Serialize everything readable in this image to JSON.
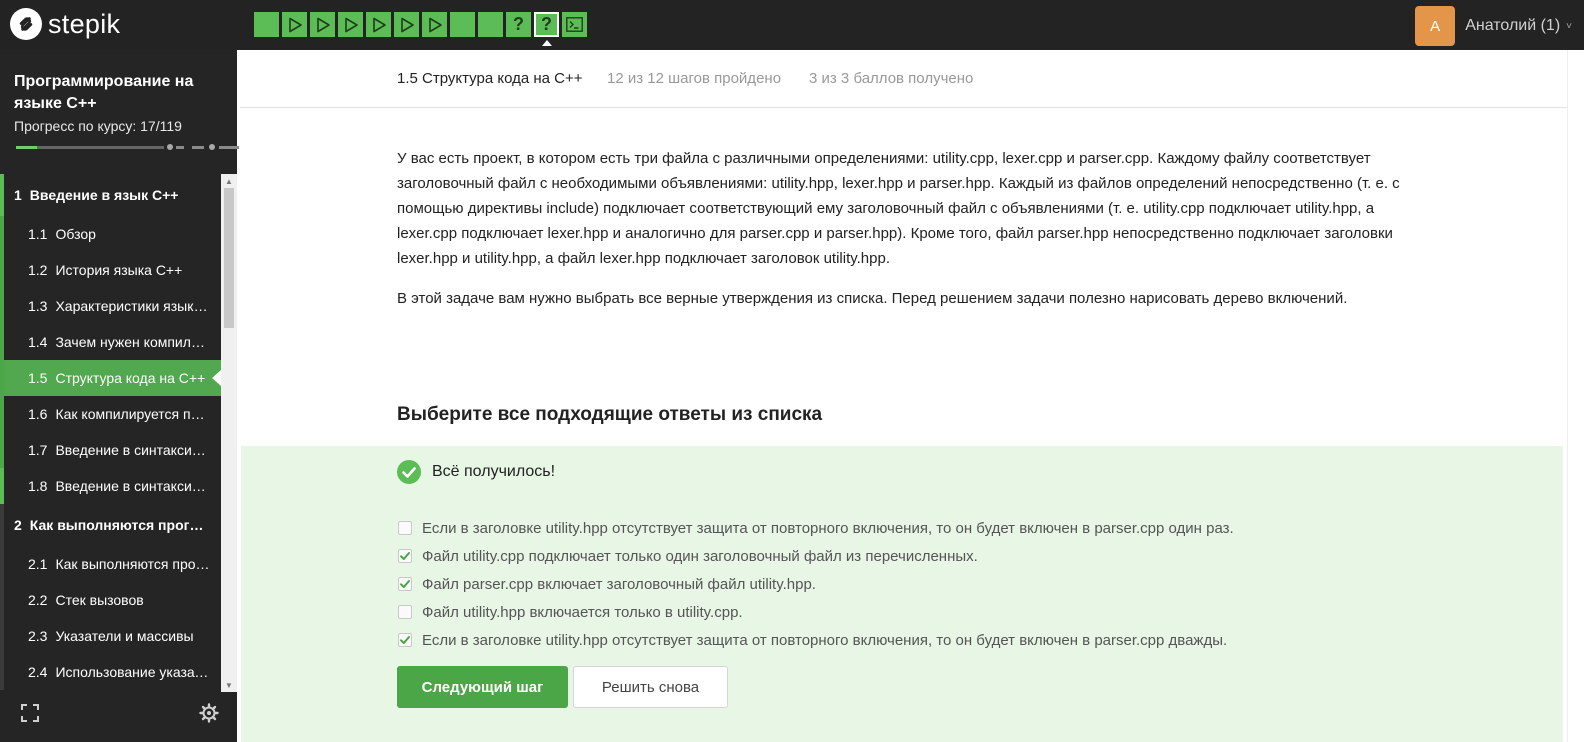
{
  "header": {
    "logo_text": "stepik",
    "steps": [
      {
        "type": "text",
        "state": "passed"
      },
      {
        "type": "video",
        "state": "passed"
      },
      {
        "type": "video",
        "state": "passed"
      },
      {
        "type": "video",
        "state": "passed"
      },
      {
        "type": "video",
        "state": "passed"
      },
      {
        "type": "video",
        "state": "passed"
      },
      {
        "type": "video",
        "state": "passed"
      },
      {
        "type": "text",
        "state": "passed"
      },
      {
        "type": "text",
        "state": "passed"
      },
      {
        "type": "quiz",
        "state": "passed",
        "glyph": "?"
      },
      {
        "type": "quiz",
        "state": "current",
        "glyph": "?"
      },
      {
        "type": "code",
        "state": "passed"
      }
    ],
    "user": {
      "avatar_letter": "А",
      "name": "Анатолий (1)",
      "caret": "˅"
    }
  },
  "sidebar": {
    "course_title": "Программирование на языке C++",
    "progress_label": "Прогресс по курсу:  17/119",
    "progress_fraction": 0.143,
    "modules": [
      {
        "number": "1",
        "label": "Введение в язык C++",
        "lessons": [
          {
            "number": "1.1",
            "label": "Обзор"
          },
          {
            "number": "1.2",
            "label": "История языка C++"
          },
          {
            "number": "1.3",
            "label": "Характеристики языка C++"
          },
          {
            "number": "1.4",
            "label": "Зачем нужен компилятор"
          },
          {
            "number": "1.5",
            "label": "Структура кода на C++",
            "active": true
          },
          {
            "number": "1.6",
            "label": "Как компилируется программа"
          },
          {
            "number": "1.7",
            "label": "Введение в синтаксис C++"
          },
          {
            "number": "1.8",
            "label": "Введение в синтаксис C++ (продолжение)"
          }
        ]
      },
      {
        "number": "2",
        "label": "Как выполняются программы",
        "lessons": [
          {
            "number": "2.1",
            "label": "Как выполняются программы"
          },
          {
            "number": "2.2",
            "label": "Стек вызовов"
          },
          {
            "number": "2.3",
            "label": "Указатели и массивы"
          },
          {
            "number": "2.4",
            "label": "Использование указателей"
          }
        ]
      }
    ]
  },
  "lesson": {
    "title": "1.5 Структура кода на C++",
    "steps_info": "12 из 12 шагов пройдено",
    "score_info": "3 из 3 баллов  получено"
  },
  "task": {
    "paragraphs": [
      "У вас есть проект, в котором есть три файла с различными определениями: utility.cpp, lexer.cpp и parser.cpp. Каждому файлу соответствует заголовочный файл с необходимыми объявлениями: utility.hpp, lexer.hpp и parser.hpp. Каждый из файлов определений непосредственно (т. е. с помощью директивы include) подключает соответствующий ему заголовочный файл с объявлениями (т. е. utility.cpp подключает utility.hpp, а lexer.cpp подключает lexer.hpp и аналогично для parser.cpp и parser.hpp). Кроме того, файл parser.hpp непосредственно подключает заголовки lexer.hpp и utility.hpp, а файл lexer.hpp подключает заголовок utility.hpp.",
      "В этой задаче вам нужно выбрать все верные утверждения из списка. Перед решением задачи полезно нарисовать дерево включений."
    ],
    "question_heading": "Выберите все подходящие ответы из списка",
    "result_text": "Всё получилось!",
    "options": [
      {
        "label": "Если в заголовке utility.hpp отсутствует защита от повторного включения, то он будет включен в parser.cpp один раз.",
        "checked": false
      },
      {
        "label": "Файл utility.cpp подключает только один заголовочный файл из перечисленных.",
        "checked": true
      },
      {
        "label": "Файл parser.cpp включает заголовочный файл utility.hpp.",
        "checked": true
      },
      {
        "label": "Файл utility.hpp включается только в utility.cpp.",
        "checked": false
      },
      {
        "label": "Если в заголовке utility.hpp отсутствует защита от повторного включения, то он будет включен в parser.cpp дважды.",
        "checked": true
      }
    ],
    "next_button": "Следующий шаг",
    "retry_button": "Решить снова"
  },
  "colors": {
    "topbar": "#232323",
    "sidebar": "#252525",
    "accent_green": "#5cbd56",
    "active_lesson": "#51a84e",
    "panel_bg": "#e8f6e6",
    "avatar": "#e3964a"
  }
}
